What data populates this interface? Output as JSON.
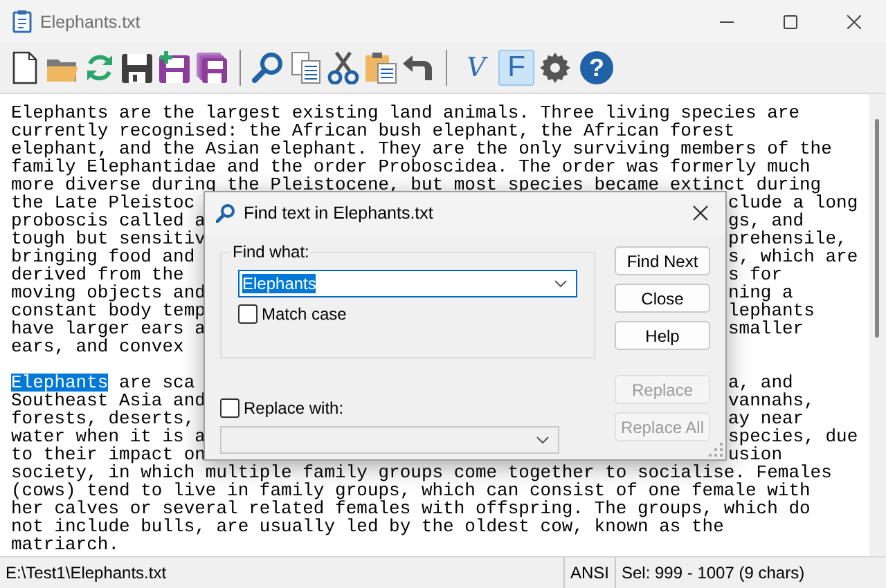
{
  "window": {
    "title": "Elephants.txt"
  },
  "toolbar": {
    "toggles": [
      {
        "label": "V",
        "selected": false
      },
      {
        "label": "F",
        "selected": true
      }
    ],
    "help_glyph": "?"
  },
  "editor": {
    "paragraphs": [
      {
        "lines": [
          {
            "parts": [
              {
                "text": "Elephants are the largest existing land animals. Three living species are",
                "selected": false
              }
            ]
          },
          {
            "parts": [
              {
                "text": "currently recognised: the African bush elephant, the African forest",
                "selected": false
              }
            ]
          },
          {
            "parts": [
              {
                "text": "elephant, and the Asian elephant. They are the only surviving members of the",
                "selected": false
              }
            ]
          },
          {
            "parts": [
              {
                "text": "family Elephantidae and the order Proboscidea. The order was formerly much",
                "selected": false
              }
            ]
          },
          {
            "parts": [
              {
                "text": "more diverse during the Pleistocene, but most species became extinct during",
                "selected": false
              }
            ]
          },
          {
            "parts": [
              {
                "text": "the Late Pleistoc",
                "selected": false
              }
            ],
            "right": "clude a long"
          },
          {
            "parts": [
              {
                "text": "proboscis called a",
                "selected": false
              }
            ],
            "right": "gs, and"
          },
          {
            "parts": [
              {
                "text": "tough but sensitiv",
                "selected": false
              }
            ],
            "right": "prehensile,"
          },
          {
            "parts": [
              {
                "text": "bringing food and",
                "selected": false
              }
            ],
            "right": "s, which are"
          },
          {
            "parts": [
              {
                "text": "derived from the",
                "selected": false
              }
            ],
            "right": "s for"
          },
          {
            "parts": [
              {
                "text": "moving objects and",
                "selected": false
              }
            ],
            "right": "ning a"
          },
          {
            "parts": [
              {
                "text": "constant body temp",
                "selected": false
              }
            ],
            "right": "lephants"
          },
          {
            "parts": [
              {
                "text": "have larger ears a",
                "selected": false
              }
            ],
            "right": "smaller"
          },
          {
            "parts": [
              {
                "text": "ears, and convex",
                "selected": false
              }
            ]
          }
        ]
      },
      {
        "lines": [
          {
            "parts": [
              {
                "text": "Elephants",
                "selected": true
              },
              {
                "text": "are sca",
                "selected": false
              }
            ],
            "right": "a, and"
          },
          {
            "parts": [
              {
                "text": "Southeast Asia and",
                "selected": false
              }
            ],
            "right": "vannahs,"
          },
          {
            "parts": [
              {
                "text": "forests, deserts,",
                "selected": false
              }
            ],
            "right": "ay near"
          },
          {
            "parts": [
              {
                "text": "water when it is a",
                "selected": false
              }
            ],
            "right": "species, due"
          },
          {
            "parts": [
              {
                "text": "to their impact on",
                "selected": false
              }
            ],
            "right": "usion"
          },
          {
            "parts": [
              {
                "text": "society, in which multiple family groups come together to socialise. Females",
                "selected": false
              }
            ]
          },
          {
            "parts": [
              {
                "text": "(cows) tend to live in family groups, which can consist of one female with",
                "selected": false
              }
            ]
          },
          {
            "parts": [
              {
                "text": "her calves or several related females with offspring. The groups, which do",
                "selected": false
              }
            ]
          },
          {
            "parts": [
              {
                "text": "not include bulls, are usually led by the oldest cow, known as the",
                "selected": false
              }
            ]
          },
          {
            "parts": [
              {
                "text": "matriarch.",
                "selected": false
              }
            ]
          }
        ]
      }
    ]
  },
  "find_dialog": {
    "title": "Find text in Elephants.txt",
    "find_label": "Find what:",
    "find_value": "Elephants",
    "match_case": {
      "label": "Match case",
      "checked": false
    },
    "replace": {
      "label": "Replace with:",
      "checked": false
    },
    "buttons": [
      {
        "label": "Find Next",
        "disabled": false
      },
      {
        "label": "Close",
        "disabled": false
      },
      {
        "label": "Help",
        "disabled": false
      },
      {
        "label": "Replace",
        "disabled": true
      },
      {
        "label": "Replace All",
        "disabled": true
      }
    ]
  },
  "status_bar": {
    "path": "E:\\Test1\\Elephants.txt",
    "encoding": "ANSI",
    "selection": "Sel: 999 - 1007 (9 chars)"
  }
}
